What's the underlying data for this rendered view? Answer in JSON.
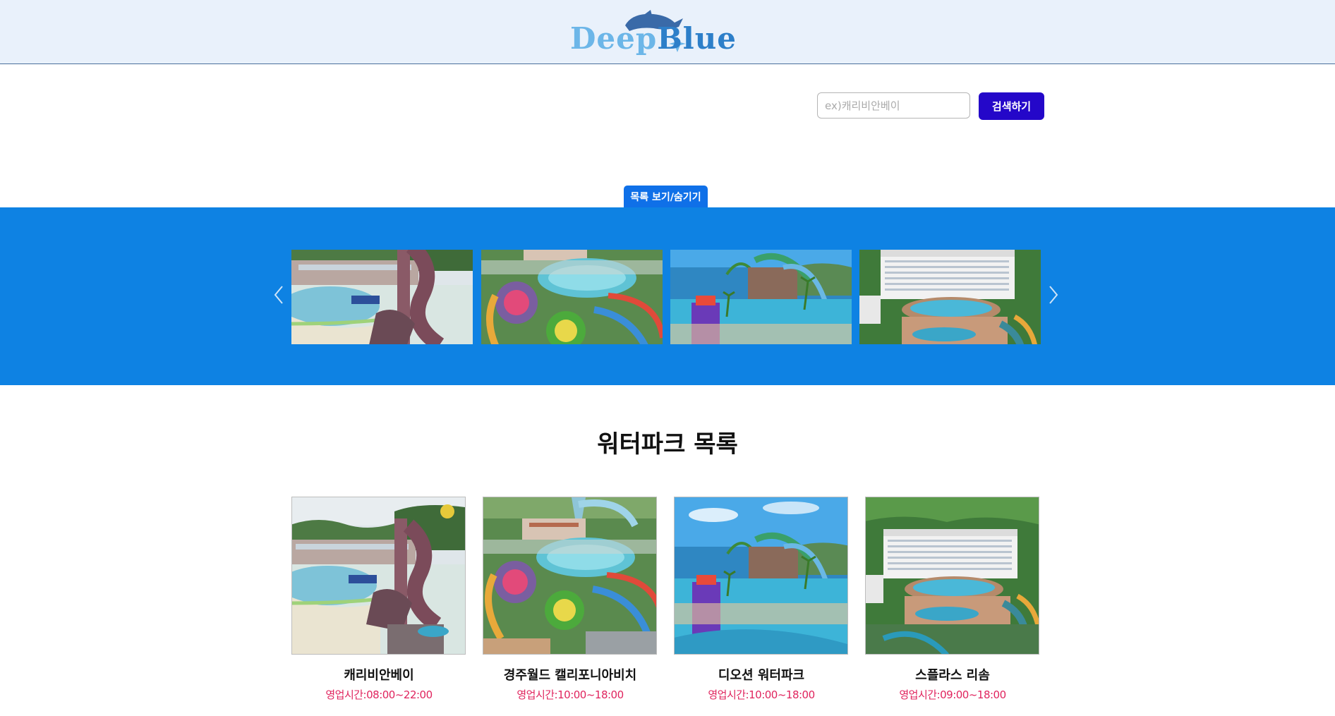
{
  "header": {
    "logo_word_1": "Deep",
    "logo_word_2": "Blue",
    "logo_icon": "dolphin-icon"
  },
  "search": {
    "placeholder": "ex)캐리비안베이",
    "value": "",
    "button_label": "검색하기"
  },
  "toggle": {
    "label": "목록 보기/숨기기"
  },
  "carousel": {
    "prev_icon": "chevron-left-icon",
    "next_icon": "chevron-right-icon",
    "slides": [
      {
        "image": "caribbean-bay-photo"
      },
      {
        "image": "gyeongju-california-beach-photo"
      },
      {
        "image": "the-ocean-waterpark-photo"
      },
      {
        "image": "splas-resom-photo"
      }
    ]
  },
  "list": {
    "title": "워터파크 목록",
    "items": [
      {
        "name": "캐리비안베이",
        "hours": "영업시간:08:00~22:00"
      },
      {
        "name": "경주월드 캘리포니아비치",
        "hours": "영업시간:10:00~18:00"
      },
      {
        "name": "디오션 워터파크",
        "hours": "영업시간:10:00~18:00"
      },
      {
        "name": "스플라스 리솜",
        "hours": "영업시간:09:00~18:00"
      }
    ]
  },
  "colors": {
    "header_bg": "#e9f1fb",
    "banner_bg": "#0e82e3",
    "search_button": "#2407c9",
    "toggle_button": "#0f70e8",
    "hours_text": "#e0245e"
  }
}
